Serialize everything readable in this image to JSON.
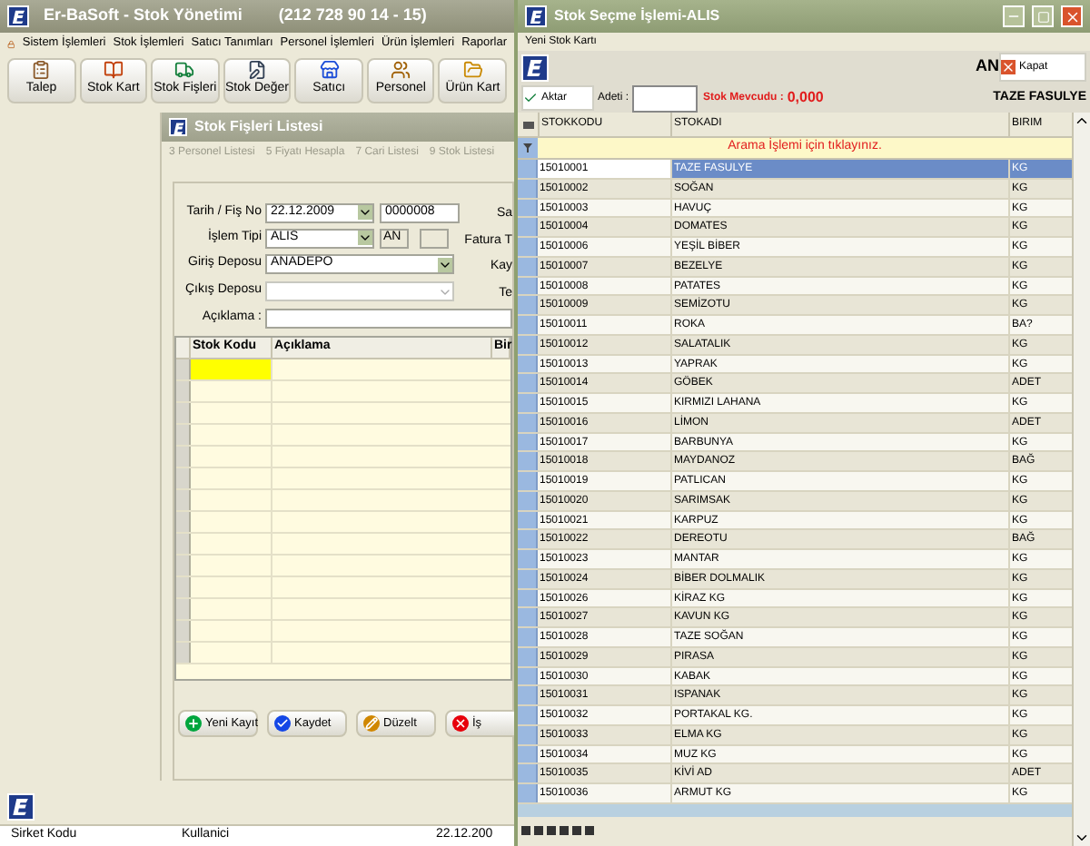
{
  "main_window": {
    "title": "Er-BaSoft - Stok Yönetimi",
    "phone": "(212 728 90 14 - 15)",
    "menu": [
      "Sistem İşlemleri",
      "Stok İşlemleri",
      "Satıcı Tanımları",
      "Personel İşlemleri",
      "Ürün İşlemleri",
      "Raporlar"
    ],
    "toolbar": [
      "Talep",
      "Stok Kart",
      "Stok Fişleri",
      "Stok Değer",
      "Satıcı",
      "Personel",
      "Ürün Kart"
    ]
  },
  "receipt_window": {
    "title": "Stok Fişleri Listesi",
    "tabs": [
      "3 Personel Listesi",
      "5 Fiyatı Hesapla",
      "7 Cari Listesi",
      "9 Stok Listesi"
    ],
    "form": {
      "date_label": "Tarih / Fiş No",
      "date": "22.12.2009",
      "receipt_no": "0000008",
      "type_label": "İşlem Tipi",
      "type": "ALIS",
      "type_code": "AN",
      "in_depot_label": "Giriş Deposu",
      "in_depot": "ANADEPO",
      "out_depot_label": "Çıkış Deposu",
      "note_label": "Açıklama :"
    },
    "side_labels": [
      "Sa",
      "Fatura T",
      "Kay",
      "Te"
    ],
    "grid_columns": [
      "Stok Kodu",
      "Açıklama",
      "Bir"
    ],
    "buttons": [
      "Yeni Kayıt",
      "Kaydet",
      "Düzelt",
      "İş"
    ]
  },
  "status_bar": [
    "Sirket Kodu",
    "Kullanici",
    "22.12.200"
  ],
  "dialog": {
    "title": "Stok Seçme İşlemi-ALIS",
    "menu": [
      "Yeni Stok Kartı"
    ],
    "code_label": "AN",
    "close_button": "Kapat",
    "transfer_button": "Aktar",
    "quantity_label": "Adeti :",
    "stock_label": "Stok Mevcudu :",
    "stock_value": "0,000",
    "selected_name": "TAZE FASULYE",
    "columns": [
      "STOKKODU",
      "STOKADI",
      "BIRIM"
    ],
    "filter_prompt": "Arama İşlemi için tıklayınız.",
    "rows": [
      {
        "code": "15010001",
        "name": "TAZE FASULYE",
        "unit": "KG",
        "selected": true
      },
      {
        "code": "15010002",
        "name": "SOĞAN",
        "unit": "KG",
        "selected": false
      },
      {
        "code": "15010003",
        "name": "HAVUÇ",
        "unit": "KG",
        "selected": false
      },
      {
        "code": "15010004",
        "name": "DOMATES",
        "unit": "KG",
        "selected": false
      },
      {
        "code": "15010006",
        "name": "YEŞİL BİBER",
        "unit": "KG",
        "selected": false
      },
      {
        "code": "15010007",
        "name": "BEZELYE",
        "unit": "KG",
        "selected": false
      },
      {
        "code": "15010008",
        "name": "PATATES",
        "unit": "KG",
        "selected": false
      },
      {
        "code": "15010009",
        "name": "SEMİZOTU",
        "unit": "KG",
        "selected": false
      },
      {
        "code": "15010011",
        "name": "ROKA",
        "unit": "BA?",
        "selected": false
      },
      {
        "code": "15010012",
        "name": "SALATALIK",
        "unit": "KG",
        "selected": false
      },
      {
        "code": "15010013",
        "name": "YAPRAK",
        "unit": "KG",
        "selected": false
      },
      {
        "code": "15010014",
        "name": "GÖBEK",
        "unit": "ADET",
        "selected": false
      },
      {
        "code": "15010015",
        "name": "KIRMIZI LAHANA",
        "unit": "KG",
        "selected": false
      },
      {
        "code": "15010016",
        "name": "LİMON",
        "unit": "ADET",
        "selected": false
      },
      {
        "code": "15010017",
        "name": "BARBUNYA",
        "unit": "KG",
        "selected": false
      },
      {
        "code": "15010018",
        "name": "MAYDANOZ",
        "unit": "BAĞ",
        "selected": false
      },
      {
        "code": "15010019",
        "name": "PATLICAN",
        "unit": "KG",
        "selected": false
      },
      {
        "code": "15010020",
        "name": "SARIMSAK",
        "unit": "KG",
        "selected": false
      },
      {
        "code": "15010021",
        "name": "KARPUZ",
        "unit": "KG",
        "selected": false
      },
      {
        "code": "15010022",
        "name": "DEREOTU",
        "unit": "BAĞ",
        "selected": false
      },
      {
        "code": "15010023",
        "name": "MANTAR",
        "unit": "KG",
        "selected": false
      },
      {
        "code": "15010024",
        "name": "BİBER DOLMALIK",
        "unit": "KG",
        "selected": false
      },
      {
        "code": "15010026",
        "name": "KİRAZ KG",
        "unit": "KG",
        "selected": false
      },
      {
        "code": "15010027",
        "name": "KAVUN KG",
        "unit": "KG",
        "selected": false
      },
      {
        "code": "15010028",
        "name": "TAZE SOĞAN",
        "unit": "KG",
        "selected": false
      },
      {
        "code": "15010029",
        "name": "PIRASA",
        "unit": "KG",
        "selected": false
      },
      {
        "code": "15010030",
        "name": "KABAK",
        "unit": "KG",
        "selected": false
      },
      {
        "code": "15010031",
        "name": "ISPANAK",
        "unit": "KG",
        "selected": false
      },
      {
        "code": "15010032",
        "name": "PORTAKAL KG.",
        "unit": "KG",
        "selected": false
      },
      {
        "code": "15010033",
        "name": "ELMA KG",
        "unit": "KG",
        "selected": false
      },
      {
        "code": "15010034",
        "name": "MUZ KG",
        "unit": "KG",
        "selected": false
      },
      {
        "code": "15010035",
        "name": "KİVİ AD",
        "unit": "ADET",
        "selected": false
      },
      {
        "code": "15010036",
        "name": "ARMUT KG",
        "unit": "KG",
        "selected": false
      }
    ]
  }
}
